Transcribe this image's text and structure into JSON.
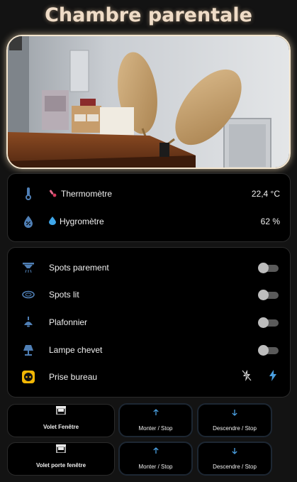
{
  "page": {
    "title": "Chambre parentale"
  },
  "photo": {
    "icon": "room-photo"
  },
  "sensors": [
    {
      "name": "Thermomètre",
      "value": "22,4 °C",
      "icon": "thermometer-icon",
      "emoji": "thermometer-emoji"
    },
    {
      "name": "Hygromètre",
      "value": "62 %",
      "icon": "water-percent-icon",
      "emoji": "droplet-emoji"
    }
  ],
  "lights": [
    {
      "name": "Spots parement",
      "icon": "ceiling-spot-icon",
      "state": "off"
    },
    {
      "name": "Spots lit",
      "icon": "ring-light-icon",
      "state": "off"
    },
    {
      "name": "Plafonnier",
      "icon": "ceiling-light-icon",
      "state": "off"
    },
    {
      "name": "Lampe chevet",
      "icon": "desk-lamp-icon",
      "state": "off"
    }
  ],
  "plug": {
    "name": "Prise bureau",
    "icon": "power-socket-icon",
    "state": "on",
    "actions": [
      "flash-off-icon",
      "flash-icon"
    ]
  },
  "shutters": [
    {
      "name": "Volet Fenêtre",
      "icon": "window-shutter-icon",
      "up_label": "Monter / Stop",
      "down_label": "Descendre / Stop"
    },
    {
      "name": "Volet porte fenêtre",
      "icon": "window-shutter-icon",
      "up_label": "Monter / Stop",
      "down_label": "Descendre / Stop"
    }
  ],
  "colors": {
    "accent_blue": "#4a9fe0",
    "icon_blue": "#4f7fb5",
    "title": "#efdcc7",
    "plug_yellow": "#f2b705",
    "toggle_off": "#5a5a5a"
  }
}
